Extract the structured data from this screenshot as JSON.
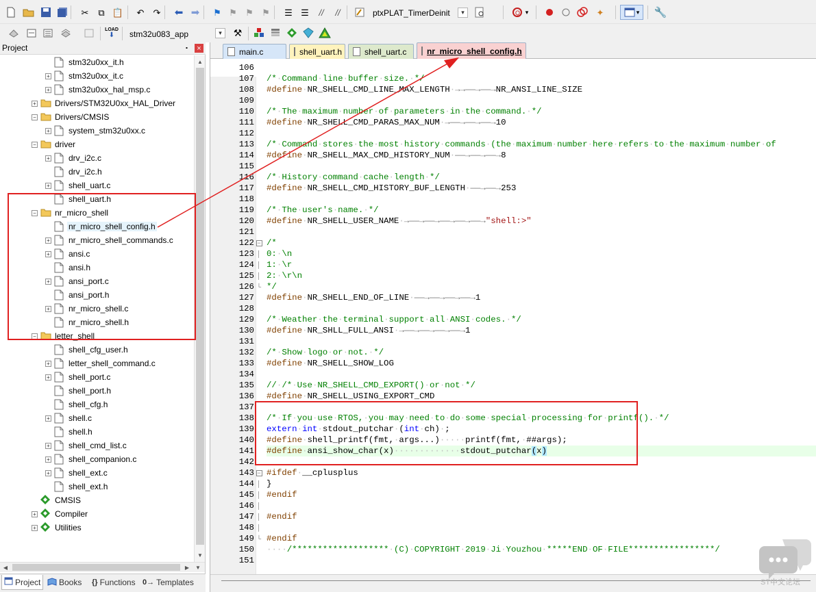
{
  "toolbar1": {
    "function_combo": "ptxPLAT_TimerDeinit",
    "icons": [
      "new-file-icon",
      "open-folder-icon",
      "save-icon",
      "save-all-icon",
      "cut-icon",
      "copy-icon",
      "paste-icon",
      "undo-icon",
      "redo-icon",
      "nav-back-icon",
      "nav-forward-icon",
      "bookmark-icon",
      "bookmark-prev-icon",
      "bookmark-next-icon",
      "bookmark-clear-icon",
      "indent-icon",
      "unindent-icon",
      "comment-icon",
      "uncomment-icon",
      "find-in-files-icon",
      "find-icon",
      "debug-start-icon",
      "breakpoint-icon",
      "breakpoint-disable-icon",
      "breakpoint-kill-icon",
      "window-layout-icon",
      "configure-icon"
    ]
  },
  "toolbar2": {
    "target_combo": "stm32u083_app",
    "load_label": "LOAD"
  },
  "project": {
    "title": "Project",
    "pin_glyph": "⬝",
    "close_glyph": "×",
    "tree": [
      {
        "label": "stm32u0xx_it.h",
        "expand": "",
        "type": "file"
      },
      {
        "label": "stm32u0xx_it.c",
        "expand": "+",
        "type": "file"
      },
      {
        "label": "stm32u0xx_hal_msp.c",
        "expand": "+",
        "type": "file"
      },
      {
        "label": "Drivers/STM32U0xx_HAL_Driver",
        "expand": "+",
        "type": "folder"
      },
      {
        "label": "Drivers/CMSIS",
        "expand": "−",
        "type": "folder"
      },
      {
        "label": "system_stm32u0xx.c",
        "expand": "+",
        "type": "file"
      },
      {
        "label": "driver",
        "expand": "−",
        "type": "folder"
      },
      {
        "label": "drv_i2c.c",
        "expand": "+",
        "type": "file"
      },
      {
        "label": "drv_i2c.h",
        "expand": "",
        "type": "file"
      },
      {
        "label": "shell_uart.c",
        "expand": "+",
        "type": "file"
      },
      {
        "label": "shell_uart.h",
        "expand": "",
        "type": "file"
      },
      {
        "label": "nr_micro_shell",
        "expand": "−",
        "type": "folder"
      },
      {
        "label": "nr_micro_shell_config.h",
        "expand": "",
        "type": "file",
        "selected": true
      },
      {
        "label": "nr_micro_shell_commands.c",
        "expand": "+",
        "type": "file"
      },
      {
        "label": "ansi.c",
        "expand": "+",
        "type": "file"
      },
      {
        "label": "ansi.h",
        "expand": "",
        "type": "file"
      },
      {
        "label": "ansi_port.c",
        "expand": "+",
        "type": "file"
      },
      {
        "label": "ansi_port.h",
        "expand": "",
        "type": "file"
      },
      {
        "label": "nr_micro_shell.c",
        "expand": "+",
        "type": "file"
      },
      {
        "label": "nr_micro_shell.h",
        "expand": "",
        "type": "file"
      },
      {
        "label": "letter_shell",
        "expand": "−",
        "type": "folder"
      },
      {
        "label": "shell_cfg_user.h",
        "expand": "",
        "type": "file"
      },
      {
        "label": "letter_shell_command.c",
        "expand": "+",
        "type": "file"
      },
      {
        "label": "shell_port.c",
        "expand": "+",
        "type": "file"
      },
      {
        "label": "shell_port.h",
        "expand": "",
        "type": "file"
      },
      {
        "label": "shell_cfg.h",
        "expand": "",
        "type": "file"
      },
      {
        "label": "shell.c",
        "expand": "+",
        "type": "file"
      },
      {
        "label": "shell.h",
        "expand": "",
        "type": "file"
      },
      {
        "label": "shell_cmd_list.c",
        "expand": "+",
        "type": "file"
      },
      {
        "label": "shell_companion.c",
        "expand": "+",
        "type": "file"
      },
      {
        "label": "shell_ext.c",
        "expand": "+",
        "type": "file"
      },
      {
        "label": "shell_ext.h",
        "expand": "",
        "type": "file"
      },
      {
        "label": "CMSIS",
        "expand": "",
        "type": "gem"
      },
      {
        "label": "Compiler",
        "expand": "+",
        "type": "gem"
      },
      {
        "label": "Utilities",
        "expand": "+",
        "type": "gem"
      }
    ],
    "bottom_tabs": [
      {
        "label": "Project",
        "icon": "project-tab-icon"
      },
      {
        "label": "Books",
        "icon": "books-tab-icon"
      },
      {
        "label": "Functions",
        "icon": "functions-tab-icon",
        "glyph": "{}"
      },
      {
        "label": "Templates",
        "icon": "templates-tab-icon",
        "glyph": "0→"
      }
    ]
  },
  "editor": {
    "tabs": [
      {
        "label": "main.c",
        "color": "#d6e6f8"
      },
      {
        "label": "shell_uart.h",
        "color": "#fff3bd"
      },
      {
        "label": "shell_uart.c",
        "color": "#dde9cc"
      },
      {
        "label": "nr_micro_shell_config.h",
        "color": "#f9d1d1",
        "active": true
      }
    ],
    "lines": [
      {
        "n": "106",
        "fold": "",
        "html": ""
      },
      {
        "n": "107",
        "fold": "",
        "html": "<span class='cm'>/*·Command·line·buffer·size.·*/</span>"
      },
      {
        "n": "108",
        "fold": "",
        "html": "<span class='pp'>#define</span>·NR_SHELL_CMD_LINE_MAX_LENGTH·→→——→——→NR_ANSI_LINE_SIZE"
      },
      {
        "n": "109",
        "fold": "",
        "html": ""
      },
      {
        "n": "110",
        "fold": "",
        "html": "<span class='cm'>/*·The·maximum·number·of·parameters·in·the·command.·*/</span>"
      },
      {
        "n": "111",
        "fold": "",
        "html": "<span class='pp'>#define</span>·NR_SHELL_CMD_PARAS_MAX_NUM·→——→——→——→10"
      },
      {
        "n": "112",
        "fold": "",
        "html": ""
      },
      {
        "n": "113",
        "fold": "",
        "html": "<span class='cm'>/*·Command·stores·the·most·history·commands·(the·maximum·number·here·refers·to·the·maximum·number·of</span>"
      },
      {
        "n": "114",
        "fold": "",
        "html": "<span class='pp'>#define</span>·NR_SHELL_MAX_CMD_HISTORY_NUM·——→——→——→8"
      },
      {
        "n": "115",
        "fold": "",
        "html": ""
      },
      {
        "n": "116",
        "fold": "",
        "html": "<span class='cm'>/*·History·command·cache·length·*/</span>"
      },
      {
        "n": "117",
        "fold": "",
        "html": "<span class='pp'>#define</span>·NR_SHELL_CMD_HISTORY_BUF_LENGTH·——→——→253"
      },
      {
        "n": "118",
        "fold": "",
        "html": ""
      },
      {
        "n": "119",
        "fold": "",
        "html": "<span class='cm'>/*·The·user's·name.·*/</span>"
      },
      {
        "n": "120",
        "fold": "",
        "html": "<span class='pp'>#define</span>·NR_SHELL_USER_NAME·→——→——→——→——→——→<span class='st'>\"shell:&gt;\"</span>"
      },
      {
        "n": "121",
        "fold": "",
        "html": ""
      },
      {
        "n": "122",
        "fold": "−",
        "html": "<span class='cm'>/*</span>"
      },
      {
        "n": "123",
        "fold": "",
        "html": "<span class='cm'>0:·\\n</span>"
      },
      {
        "n": "124",
        "fold": "",
        "html": "<span class='cm'>1:·\\r</span>"
      },
      {
        "n": "125",
        "fold": "",
        "html": "<span class='cm'>2:·\\r\\n</span>"
      },
      {
        "n": "126",
        "fold": "└",
        "html": "<span class='cm'>*/</span>"
      },
      {
        "n": "127",
        "fold": "",
        "html": "<span class='pp'>#define</span>·NR_SHELL_END_OF_LINE·——→——→——→——→1"
      },
      {
        "n": "128",
        "fold": "",
        "html": ""
      },
      {
        "n": "129",
        "fold": "",
        "html": "<span class='cm'>/*·Weather·the·terminal·support·all·ANSI·codes.·*/</span>"
      },
      {
        "n": "130",
        "fold": "",
        "html": "<span class='pp'>#define</span>·NR_SHLL_FULL_ANSI·→——→——→——→——→1"
      },
      {
        "n": "131",
        "fold": "",
        "html": ""
      },
      {
        "n": "132",
        "fold": "",
        "html": "<span class='cm'>/*·Show·logo·or·not.·*/</span>"
      },
      {
        "n": "133",
        "fold": "",
        "html": "<span class='pp'>#define</span>·NR_SHELL_SHOW_LOG"
      },
      {
        "n": "134",
        "fold": "",
        "html": ""
      },
      {
        "n": "135",
        "fold": "",
        "html": "<span class='cm'>//·/*·Use·NR_SHELL_CMD_EXPORT()·or·not·*/</span>"
      },
      {
        "n": "136",
        "fold": "",
        "html": "<span class='pp'>#define</span>·NR_SHELL_USING_EXPORT_CMD"
      },
      {
        "n": "137",
        "fold": "",
        "html": ""
      },
      {
        "n": "138",
        "fold": "",
        "html": "<span class='cm'>/*·If·you·use·RTOS,·you·may·need·to·do·some·special·processing·for·printf().·*/</span>"
      },
      {
        "n": "139",
        "fold": "",
        "html": "<span class='kw'>extern</span>·<span class='kw'>int</span>·stdout_putchar·(<span class='kw'>int</span>·ch)·;"
      },
      {
        "n": "140",
        "fold": "",
        "html": "<span class='pp'>#define</span>·shell_printf(fmt,·args...)·····printf(fmt,·##args);"
      },
      {
        "n": "141",
        "fold": "",
        "hl": true,
        "html": "<span class='pp'>#define</span>·ansi_show_char(x)·············stdout_putchar<span class='br'>(</span>x<span class='br'>)</span>"
      },
      {
        "n": "142",
        "fold": "",
        "html": ""
      },
      {
        "n": "143",
        "fold": "−",
        "html": "<span class='pp'>#ifdef</span>·__cplusplus"
      },
      {
        "n": "144",
        "fold": "",
        "html": "}"
      },
      {
        "n": "145",
        "fold": "",
        "html": "<span class='pp'>#endif</span>"
      },
      {
        "n": "146",
        "fold": "",
        "html": ""
      },
      {
        "n": "147",
        "fold": "",
        "html": "<span class='pp'>#endif</span>"
      },
      {
        "n": "148",
        "fold": "",
        "html": ""
      },
      {
        "n": "149",
        "fold": "└",
        "html": "<span class='pp'>#endif</span>"
      },
      {
        "n": "150",
        "fold": "",
        "html": "<span class='cm'>····/*******************·(C)·COPYRIGHT·2019·Ji·Youzhou·*****END·OF·FILE*****************/</span>"
      },
      {
        "n": "151",
        "fold": "",
        "html": ""
      }
    ]
  },
  "annotation": {
    "color": "#e02020"
  },
  "watermark": {
    "text": "ST中文论坛"
  }
}
